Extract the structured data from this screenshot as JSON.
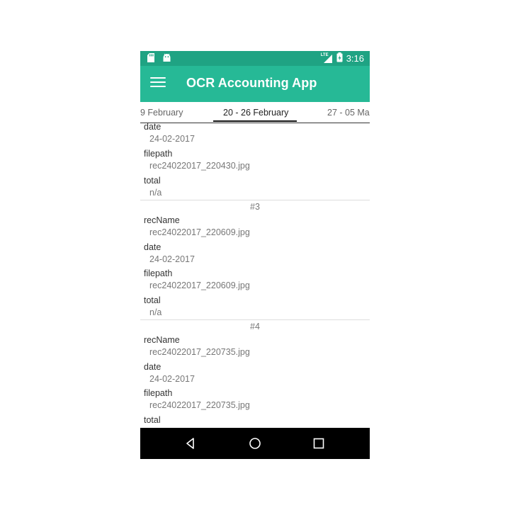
{
  "status_bar": {
    "left_icons": [
      "sd-card-icon",
      "android-icon"
    ],
    "network": "LTE",
    "time": "3:16"
  },
  "app_bar": {
    "title": "OCR Accounting App"
  },
  "tabs": [
    {
      "label": "9 February"
    },
    {
      "label": "20 - 26 February",
      "active": true
    },
    {
      "label": "27 - 05 Ma"
    }
  ],
  "records": [
    {
      "fields": [
        {
          "label": "date",
          "value": "24-02-2017"
        },
        {
          "label": "filepath",
          "value": "rec24022017_220430.jpg"
        },
        {
          "label": "total",
          "value": "n/a"
        }
      ]
    },
    {
      "number": "#3",
      "fields": [
        {
          "label": "recName",
          "value": "rec24022017_220609.jpg"
        },
        {
          "label": "date",
          "value": "24-02-2017"
        },
        {
          "label": "filepath",
          "value": "rec24022017_220609.jpg"
        },
        {
          "label": "total",
          "value": "n/a"
        }
      ]
    },
    {
      "number": "#4",
      "fields": [
        {
          "label": "recName",
          "value": "rec24022017_220735.jpg"
        },
        {
          "label": "date",
          "value": "24-02-2017"
        },
        {
          "label": "filepath",
          "value": "rec24022017_220735.jpg"
        },
        {
          "label": "total",
          "value": ""
        }
      ]
    }
  ],
  "colors": {
    "status_bar": "#1fa383",
    "app_bar": "#26b996",
    "nav_bar": "#000000"
  }
}
